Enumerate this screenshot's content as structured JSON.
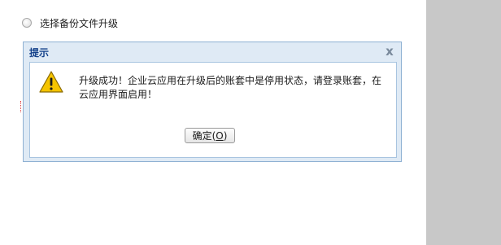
{
  "backup_option": {
    "label": "选择备份文件升级"
  },
  "dialog": {
    "title": "提示",
    "close_glyph": "x",
    "icon": "warning-icon",
    "message": "升级成功！企业云应用在升级后的账套中是停用状态，请登录账套，在云应用界面启用！",
    "ok_button": {
      "label": "确定(",
      "mnemonic": "O",
      "suffix": ")"
    }
  },
  "colors": {
    "title_text": "#15428b",
    "dialog_frame": "#dfeaf5",
    "dialog_border": "#8fb1d3",
    "warning_fill": "#f5c400",
    "right_panel": "#c8c8c8"
  }
}
